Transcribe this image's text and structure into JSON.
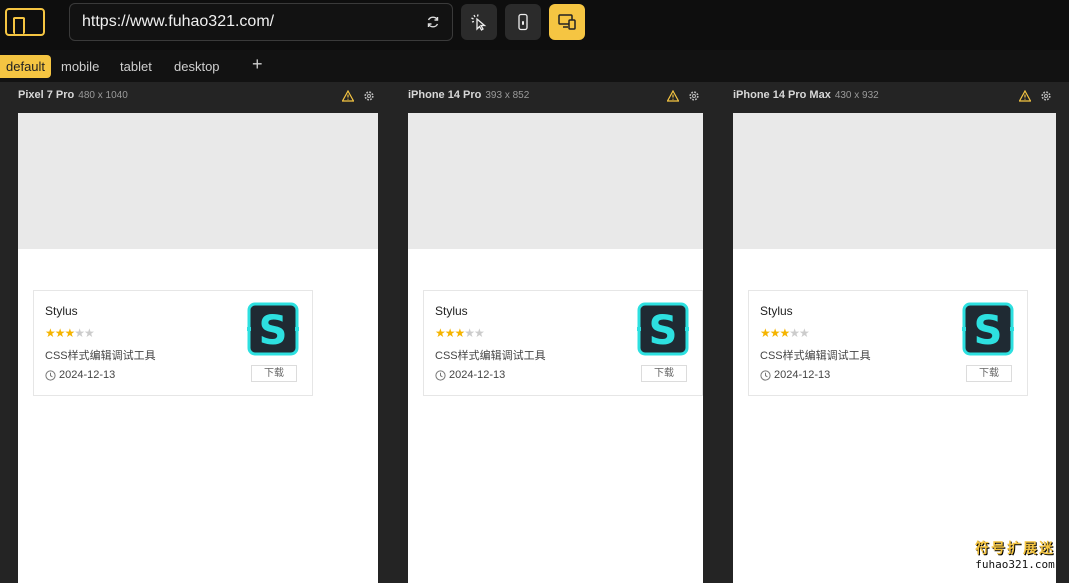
{
  "toolbar": {
    "url": "https://www.fuhao321.com/",
    "icons": [
      "app-logo-icon",
      "refresh-icon",
      "inspect-cursor-icon",
      "mobile-device-icon",
      "responsive-devices-icon"
    ]
  },
  "tabs": [
    {
      "label": "default",
      "active": true
    },
    {
      "label": "mobile",
      "active": false
    },
    {
      "label": "tablet",
      "active": false
    },
    {
      "label": "desktop",
      "active": false
    }
  ],
  "add_tab": "+",
  "colors": {
    "accent": "#f5c542",
    "star_on": "#f5b400",
    "star_off": "#cccccc",
    "icon_teal": "#2de0e0"
  },
  "devices": [
    {
      "name": "Pixel 7 Pro",
      "resolution": "480 x 1040"
    },
    {
      "name": "iPhone 14 Pro",
      "resolution": "393 x 852"
    },
    {
      "name": "iPhone 14 Pro Max",
      "resolution": "430 x 932"
    }
  ],
  "card": {
    "title": "Stylus",
    "rating": 3,
    "rating_max": 5,
    "description": "CSS样式编辑调试工具",
    "date": "2024-12-13",
    "download_label": "下载",
    "icon_letter": "S"
  },
  "watermark": {
    "cn": "符号扩展迷",
    "en": "fuhao321.com"
  }
}
